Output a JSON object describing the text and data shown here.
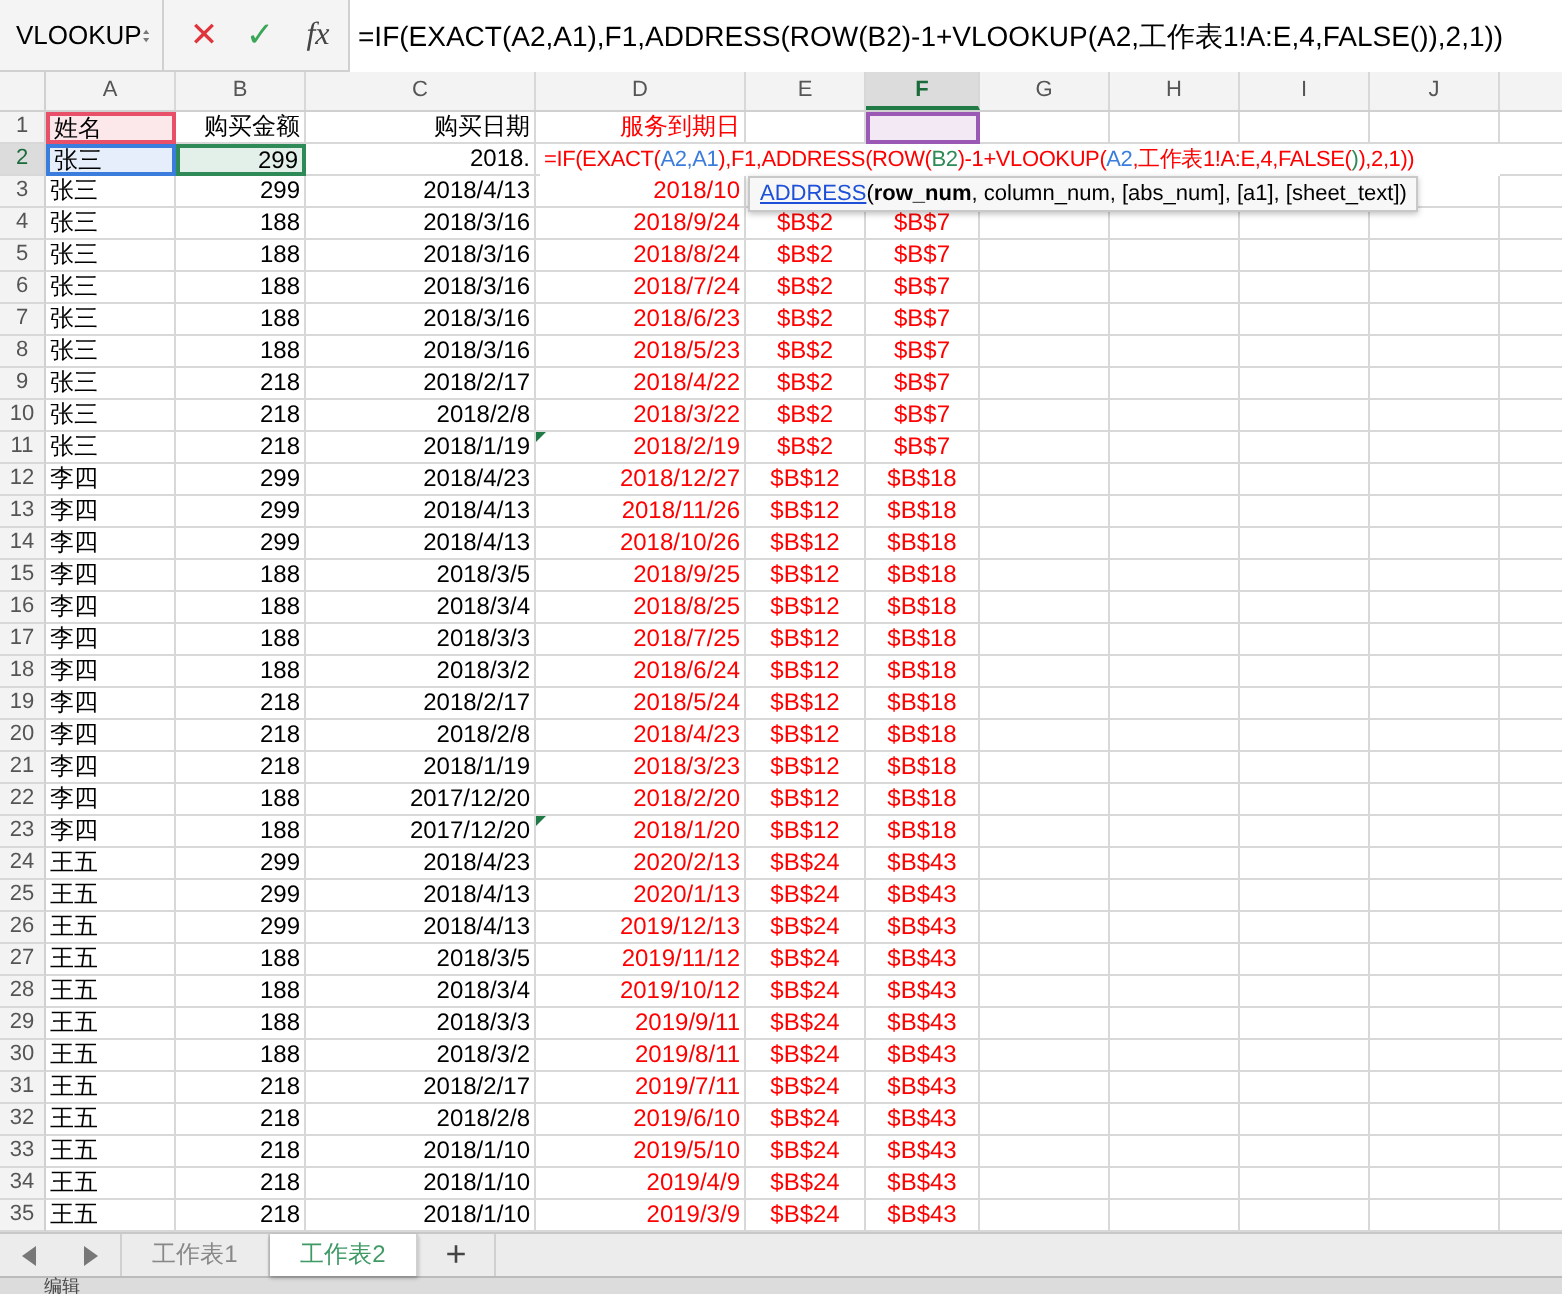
{
  "formula_bar": {
    "name_box": "VLOOKUP",
    "cancel": "✕",
    "confirm": "✓",
    "fx": "fx",
    "formula": "=IF(EXACT(A2,A1),F1,ADDRESS(ROW(B2)-1+VLOOKUP(A2,工作表1!A:E,4,FALSE()),2,1))"
  },
  "columns": [
    {
      "label": "A",
      "selected": false,
      "kind": "value"
    },
    {
      "label": "B",
      "selected": false,
      "kind": "value"
    },
    {
      "label": "C",
      "selected": false,
      "kind": "value"
    },
    {
      "label": "D",
      "selected": false,
      "kind": "formula"
    },
    {
      "label": "E",
      "selected": false,
      "kind": "formula"
    },
    {
      "label": "F",
      "selected": true,
      "kind": "formula"
    },
    {
      "label": "G",
      "selected": false,
      "kind": "value"
    },
    {
      "label": "H",
      "selected": false,
      "kind": "value"
    },
    {
      "label": "I",
      "selected": false,
      "kind": "value"
    },
    {
      "label": "J",
      "selected": false,
      "kind": "value"
    }
  ],
  "rows": [
    {
      "n": "1",
      "selected": false,
      "flag": false,
      "cells": [
        {
          "text": "姓名",
          "color": "#e8506a"
        },
        "购买金额",
        "购买日期",
        "服务到期日",
        null,
        {
          "color": "#9b59b6"
        }
      ]
    },
    {
      "n": "2",
      "selected": true,
      "flag": false,
      "cells": [
        {
          "text": "张三",
          "color": "#3b7ddd"
        },
        {
          "text": "299",
          "color": "#2e8b57"
        },
        "2018."
      ]
    },
    {
      "n": "3",
      "selected": false,
      "flag": false,
      "cells": [
        "张三",
        "299",
        "2018/4/13",
        "2018/10"
      ]
    },
    {
      "n": "4",
      "selected": false,
      "flag": false,
      "cells": [
        "张三",
        "188",
        "2018/3/16",
        "2018/9/24",
        "$B$2",
        "$B$7"
      ]
    },
    {
      "n": "5",
      "selected": false,
      "flag": false,
      "cells": [
        "张三",
        "188",
        "2018/3/16",
        "2018/8/24",
        "$B$2",
        "$B$7"
      ]
    },
    {
      "n": "6",
      "selected": false,
      "flag": false,
      "cells": [
        "张三",
        "188",
        "2018/3/16",
        "2018/7/24",
        "$B$2",
        "$B$7"
      ]
    },
    {
      "n": "7",
      "selected": false,
      "flag": false,
      "cells": [
        "张三",
        "188",
        "2018/3/16",
        "2018/6/23",
        "$B$2",
        "$B$7"
      ]
    },
    {
      "n": "8",
      "selected": false,
      "flag": false,
      "cells": [
        "张三",
        "188",
        "2018/3/16",
        "2018/5/23",
        "$B$2",
        "$B$7"
      ]
    },
    {
      "n": "9",
      "selected": false,
      "flag": false,
      "cells": [
        "张三",
        "218",
        "2018/2/17",
        "2018/4/22",
        "$B$2",
        "$B$7"
      ]
    },
    {
      "n": "10",
      "selected": false,
      "flag": false,
      "cells": [
        "张三",
        "218",
        "2018/2/8",
        "2018/3/22",
        "$B$2",
        "$B$7"
      ]
    },
    {
      "n": "11",
      "selected": false,
      "flag": true,
      "cells": [
        "张三",
        "218",
        "2018/1/19",
        "2018/2/19",
        "$B$2",
        "$B$7"
      ]
    },
    {
      "n": "12",
      "selected": false,
      "flag": false,
      "cells": [
        "李四",
        "299",
        "2018/4/23",
        "2018/12/27",
        "$B$12",
        "$B$18"
      ]
    },
    {
      "n": "13",
      "selected": false,
      "flag": false,
      "cells": [
        "李四",
        "299",
        "2018/4/13",
        "2018/11/26",
        "$B$12",
        "$B$18"
      ]
    },
    {
      "n": "14",
      "selected": false,
      "flag": false,
      "cells": [
        "李四",
        "299",
        "2018/4/13",
        "2018/10/26",
        "$B$12",
        "$B$18"
      ]
    },
    {
      "n": "15",
      "selected": false,
      "flag": false,
      "cells": [
        "李四",
        "188",
        "2018/3/5",
        "2018/9/25",
        "$B$12",
        "$B$18"
      ]
    },
    {
      "n": "16",
      "selected": false,
      "flag": false,
      "cells": [
        "李四",
        "188",
        "2018/3/4",
        "2018/8/25",
        "$B$12",
        "$B$18"
      ]
    },
    {
      "n": "17",
      "selected": false,
      "flag": false,
      "cells": [
        "李四",
        "188",
        "2018/3/3",
        "2018/7/25",
        "$B$12",
        "$B$18"
      ]
    },
    {
      "n": "18",
      "selected": false,
      "flag": false,
      "cells": [
        "李四",
        "188",
        "2018/3/2",
        "2018/6/24",
        "$B$12",
        "$B$18"
      ]
    },
    {
      "n": "19",
      "selected": false,
      "flag": false,
      "cells": [
        "李四",
        "218",
        "2018/2/17",
        "2018/5/24",
        "$B$12",
        "$B$18"
      ]
    },
    {
      "n": "20",
      "selected": false,
      "flag": false,
      "cells": [
        "李四",
        "218",
        "2018/2/8",
        "2018/4/23",
        "$B$12",
        "$B$18"
      ]
    },
    {
      "n": "21",
      "selected": false,
      "flag": false,
      "cells": [
        "李四",
        "218",
        "2018/1/19",
        "2018/3/23",
        "$B$12",
        "$B$18"
      ]
    },
    {
      "n": "22",
      "selected": false,
      "flag": false,
      "cells": [
        "李四",
        "188",
        "2017/12/20",
        "2018/2/20",
        "$B$12",
        "$B$18"
      ]
    },
    {
      "n": "23",
      "selected": false,
      "flag": true,
      "cells": [
        "李四",
        "188",
        "2017/12/20",
        "2018/1/20",
        "$B$12",
        "$B$18"
      ]
    },
    {
      "n": "24",
      "selected": false,
      "flag": false,
      "cells": [
        "王五",
        "299",
        "2018/4/23",
        "2020/2/13",
        "$B$24",
        "$B$43"
      ]
    },
    {
      "n": "25",
      "selected": false,
      "flag": false,
      "cells": [
        "王五",
        "299",
        "2018/4/13",
        "2020/1/13",
        "$B$24",
        "$B$43"
      ]
    },
    {
      "n": "26",
      "selected": false,
      "flag": false,
      "cells": [
        "王五",
        "299",
        "2018/4/13",
        "2019/12/13",
        "$B$24",
        "$B$43"
      ]
    },
    {
      "n": "27",
      "selected": false,
      "flag": false,
      "cells": [
        "王五",
        "188",
        "2018/3/5",
        "2019/11/12",
        "$B$24",
        "$B$43"
      ]
    },
    {
      "n": "28",
      "selected": false,
      "flag": false,
      "cells": [
        "王五",
        "188",
        "2018/3/4",
        "2019/10/12",
        "$B$24",
        "$B$43"
      ]
    },
    {
      "n": "29",
      "selected": false,
      "flag": false,
      "cells": [
        "王五",
        "188",
        "2018/3/3",
        "2019/9/11",
        "$B$24",
        "$B$43"
      ]
    },
    {
      "n": "30",
      "selected": false,
      "flag": false,
      "cells": [
        "王五",
        "188",
        "2018/3/2",
        "2019/8/11",
        "$B$24",
        "$B$43"
      ]
    },
    {
      "n": "31",
      "selected": false,
      "flag": false,
      "cells": [
        "王五",
        "218",
        "2018/2/17",
        "2019/7/11",
        "$B$24",
        "$B$43"
      ]
    },
    {
      "n": "32",
      "selected": false,
      "flag": false,
      "cells": [
        "王五",
        "218",
        "2018/2/8",
        "2019/6/10",
        "$B$24",
        "$B$43"
      ]
    },
    {
      "n": "33",
      "selected": false,
      "flag": false,
      "cells": [
        "王五",
        "218",
        "2018/1/10",
        "2019/5/10",
        "$B$24",
        "$B$43"
      ]
    },
    {
      "n": "34",
      "selected": false,
      "flag": false,
      "cells": [
        "王五",
        "218",
        "2018/1/10",
        "2019/4/9",
        "$B$24",
        "$B$43"
      ]
    },
    {
      "n": "35",
      "selected": false,
      "flag": false,
      "cells": [
        "王五",
        "218",
        "2018/1/10",
        "2019/3/9",
        "$B$24",
        "$B$43"
      ]
    }
  ],
  "cell_editor": {
    "segments": [
      {
        "text": "=IF(EXACT(",
        "color": "#ff0000"
      },
      {
        "text": "A2,A1",
        "color": "#3b7ddd"
      },
      {
        "text": "),F1,ADDRESS(ROW(",
        "color": "#ff0000"
      },
      {
        "text": "B2",
        "color": "#2e8b57"
      },
      {
        "text": ")-1+VLOOKUP(",
        "color": "#ff0000"
      },
      {
        "text": "A2",
        "color": "#3b7ddd"
      },
      {
        "text": ",工作表1!A:E,4,FALSE(",
        "color": "#ff0000"
      },
      {
        "text": ")",
        "color": "#2e8b57"
      },
      {
        "text": "),2,1))",
        "color": "#ff0000"
      }
    ]
  },
  "tooltip": {
    "function": "ADDRESS",
    "signature": "(**row_num**, column_num, [abs_num], [a1], [sheet_text])"
  },
  "sheet_tabs": [
    {
      "label": "工作表1",
      "selected": false
    },
    {
      "label": "工作表2",
      "selected": true
    }
  ],
  "add_sheet": "+",
  "status_bar": {
    "mode": "编辑"
  }
}
